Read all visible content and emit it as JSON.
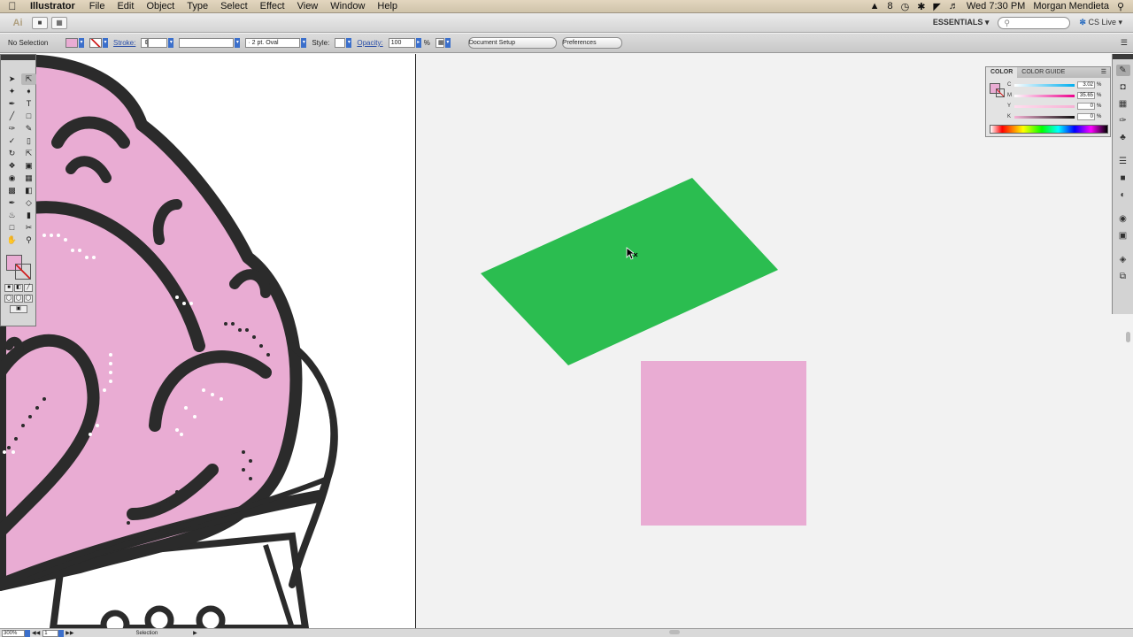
{
  "menubar": {
    "app": "Illustrator",
    "menus": [
      "File",
      "Edit",
      "Object",
      "Type",
      "Select",
      "Effect",
      "View",
      "Window",
      "Help"
    ],
    "status_count": "8",
    "clock": "Wed 7:30 PM",
    "user": "Morgan Mendieta"
  },
  "appbar": {
    "logo": "Ai",
    "workspace": "ESSENTIALS",
    "cslive": "CS Live"
  },
  "controlbar": {
    "selection": "No Selection",
    "stroke_label": "Stroke:",
    "brush": "2 pt. Oval",
    "style_label": "Style:",
    "opacity_label": "Opacity:",
    "opacity_value": "100",
    "opacity_unit": "%",
    "document_setup": "Document Setup",
    "preferences": "Preferences"
  },
  "color_panel": {
    "tab_color": "COLOR",
    "tab_guide": "COLOR GUIDE",
    "channels": [
      {
        "label": "C",
        "value": "3.02"
      },
      {
        "label": "M",
        "value": "35.65"
      },
      {
        "label": "Y",
        "value": "0"
      },
      {
        "label": "K",
        "value": "0"
      }
    ],
    "unit": "%"
  },
  "statusbar": {
    "zoom": "300%",
    "page": "1",
    "tool": "Selection"
  },
  "colors": {
    "pink": "#e9acd3",
    "green": "#2bbd50",
    "ink": "#2b2b2b"
  }
}
